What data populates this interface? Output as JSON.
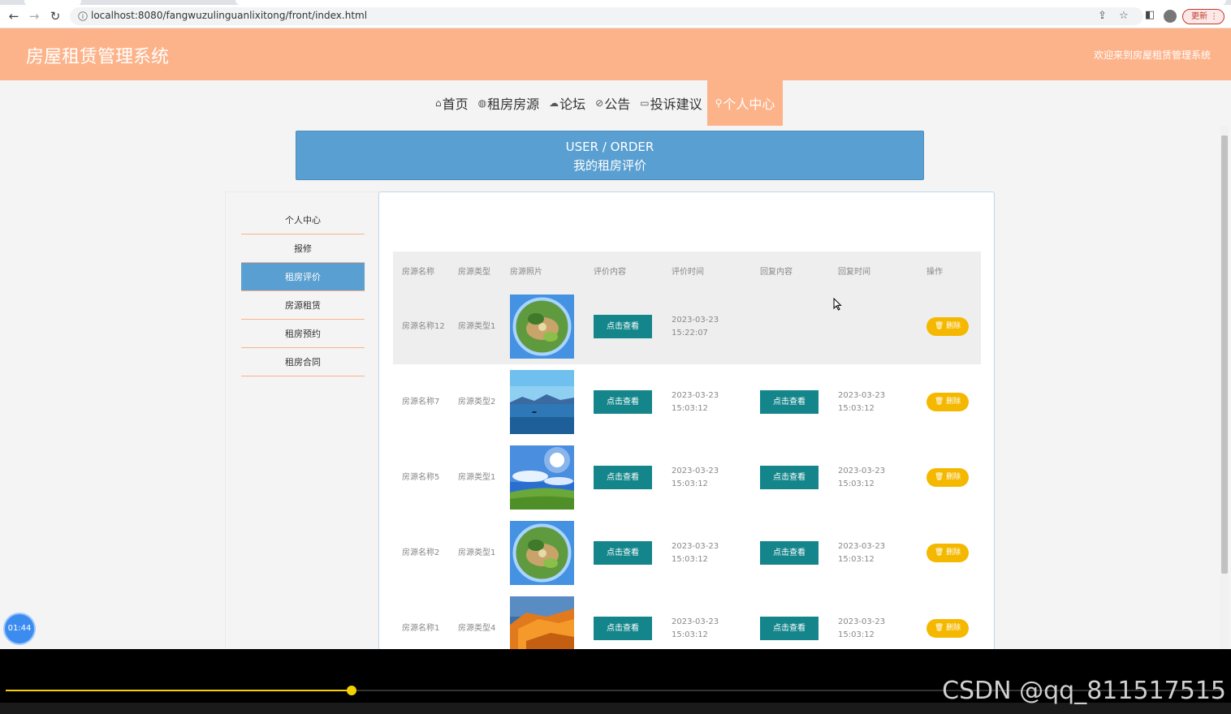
{
  "browser": {
    "url": "localhost:8080/fangwuzulinguanlixitong/front/index.html",
    "update_label": "更新"
  },
  "header": {
    "title": "房屋租赁管理系统",
    "welcome": "欢迎来到房屋租赁管理系统"
  },
  "nav": [
    {
      "icon": "home-icon",
      "glyph": "⌂",
      "label": "首页"
    },
    {
      "icon": "globe-icon",
      "glyph": "◍",
      "label": "租房房源"
    },
    {
      "icon": "cloud-icon",
      "glyph": "☁",
      "label": "论坛"
    },
    {
      "icon": "notice-icon",
      "glyph": "⊘",
      "label": "公告"
    },
    {
      "icon": "note-icon",
      "glyph": "▭",
      "label": "投诉建议"
    },
    {
      "icon": "user-icon",
      "glyph": "⚲",
      "label": "个人中心"
    }
  ],
  "banner": {
    "en": "USER / ORDER",
    "zh": "我的租房评价"
  },
  "sidebar": {
    "items": [
      "个人中心",
      "报修",
      "租房评价",
      "房源租赁",
      "租房预约",
      "租房合同"
    ],
    "active_index": 2
  },
  "table": {
    "headers": [
      "房源名称",
      "房源类型",
      "房源照片",
      "评价内容",
      "评价时间",
      "回复内容",
      "回复时间",
      "操作"
    ],
    "view_label": "点击查看",
    "delete_label": "删除",
    "rows": [
      {
        "name": "房源名称12",
        "type": "房源类型1",
        "photo": "planet",
        "eval_time": "2023-03-23 15:22:07",
        "reply": false,
        "reply_time": ""
      },
      {
        "name": "房源名称7",
        "type": "房源类型2",
        "photo": "lake",
        "eval_time": "2023-03-23 15:03:12",
        "reply": true,
        "reply_time": "2023-03-23 15:03:12"
      },
      {
        "name": "房源名称5",
        "type": "房源类型1",
        "photo": "sky",
        "eval_time": "2023-03-23 15:03:12",
        "reply": true,
        "reply_time": "2023-03-23 15:03:12"
      },
      {
        "name": "房源名称2",
        "type": "房源类型1",
        "photo": "planet",
        "eval_time": "2023-03-23 15:03:12",
        "reply": true,
        "reply_time": "2023-03-23 15:03:12"
      },
      {
        "name": "房源名称1",
        "type": "房源类型4",
        "photo": "rock",
        "eval_time": "2023-03-23 15:03:12",
        "reply": true,
        "reply_time": "2023-03-23 15:03:12"
      }
    ]
  },
  "timer": "01:44",
  "video": {
    "progress": 0.284,
    "watermark": "CSDN @qq_811517515"
  },
  "colors": {
    "header": "#fdb38a",
    "banner": "#5a9fd1",
    "view_button": "#14868b",
    "delete_button": "#f5b800"
  }
}
